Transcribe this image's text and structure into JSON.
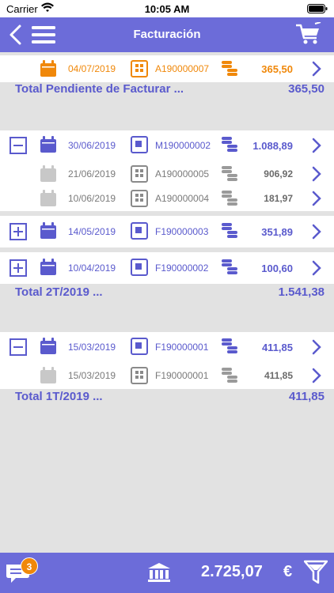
{
  "status_bar": {
    "carrier": "Carrier",
    "time": "10:05 AM"
  },
  "navbar": {
    "title": "Facturación"
  },
  "rows": [
    {
      "date": "04/07/2019",
      "doc": "A190000007",
      "amount": "365,50"
    },
    {
      "date": "30/06/2019",
      "doc": "M190000002",
      "amount": "1.088,89"
    },
    {
      "date": "21/06/2019",
      "doc": "A190000005",
      "amount": "906,92"
    },
    {
      "date": "10/06/2019",
      "doc": "A190000004",
      "amount": "181,97"
    },
    {
      "date": "14/05/2019",
      "doc": "F190000003",
      "amount": "351,89"
    },
    {
      "date": "10/04/2019",
      "doc": "F190000002",
      "amount": "100,60"
    },
    {
      "date": "15/03/2019",
      "doc": "F190000001",
      "amount": "411,85"
    },
    {
      "date": "15/03/2019",
      "doc": "F190000001",
      "amount": "411,85"
    }
  ],
  "totals": {
    "pending": {
      "label": "Total Pendiente de Facturar ...",
      "value": "365,50"
    },
    "q2": {
      "label": "Total 2T/2019 ...",
      "value": "1.541,38"
    },
    "q1": {
      "label": "Total 1T/2019 ...",
      "value": "411,85"
    }
  },
  "bottom": {
    "badge": "3",
    "total": "2.725,07",
    "currency": "€"
  },
  "colors": {
    "accent": "#6c6cd9",
    "orange": "#f0880a",
    "grey": "#7a7a7a",
    "blue_text": "#5a5acd"
  }
}
